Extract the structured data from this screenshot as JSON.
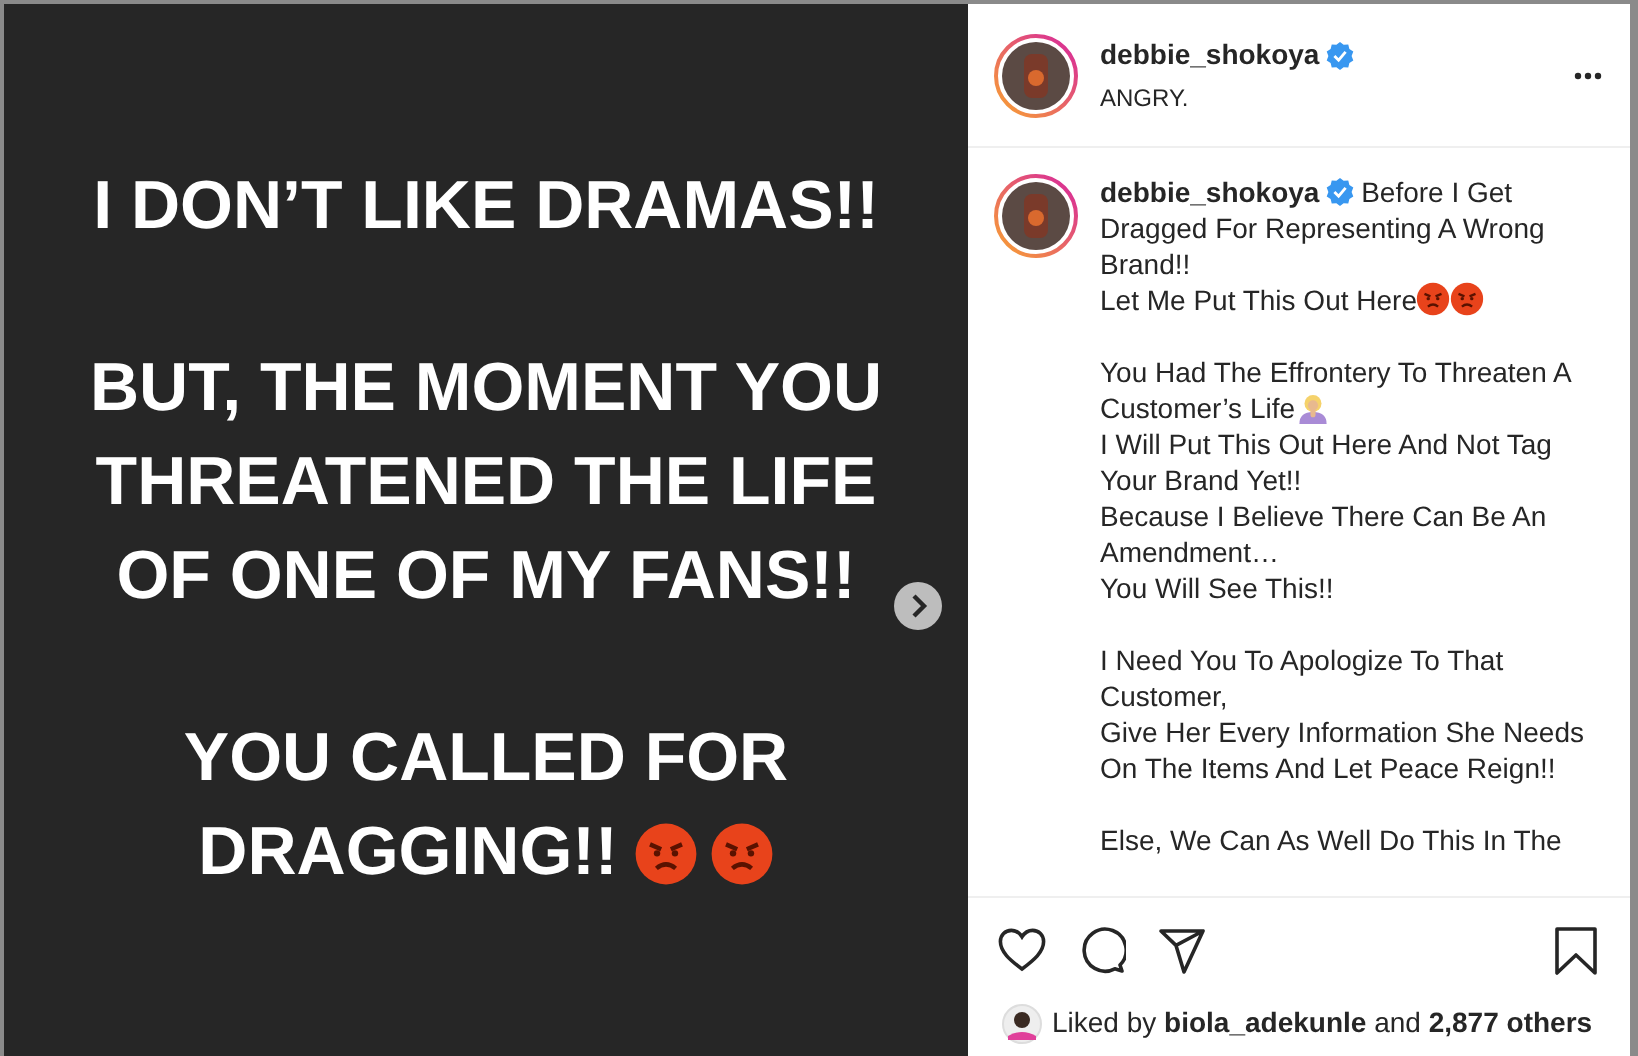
{
  "post_image": {
    "blocks": [
      {
        "lines": [
          {
            "text": "I DON’T LIKE DRAMAS!!"
          }
        ]
      },
      {
        "lines": [
          {
            "text": "BUT, THE MOMENT YOU"
          },
          {
            "text": "THREATENED THE LIFE"
          },
          {
            "text": "OF ONE OF MY FANS!!"
          }
        ]
      },
      {
        "lines": [
          {
            "text": "YOU CALLED FOR"
          },
          {
            "text": "DRAGGING!!",
            "emojis": [
              {
                "kind": "angry"
              },
              {
                "kind": "angry"
              }
            ]
          }
        ]
      }
    ]
  },
  "header": {
    "username": "debbie_shokoya",
    "verified": true,
    "location": "ANGRY."
  },
  "caption": {
    "username": "debbie_shokoya",
    "verified": true,
    "paragraphs": [
      [
        {
          "text": "Before I Get"
        },
        {
          "text": "Dragged For Representing A Wrong"
        },
        {
          "text": "Brand!!"
        },
        {
          "text": "Let Me Put This Out Here",
          "emojis": [
            {
              "kind": "angry"
            },
            {
              "kind": "angry"
            }
          ]
        }
      ],
      [
        {
          "text": "You Had The Effrontery To Threaten A"
        },
        {
          "text": "Customer’s Life",
          "emojis": [
            {
              "kind": "facepalm"
            }
          ]
        },
        {
          "text": "I Will Put This Out Here And Not Tag"
        },
        {
          "text": "Your Brand Yet!!"
        },
        {
          "text": "Because I Believe There Can Be An"
        },
        {
          "text": "Amendment…"
        },
        {
          "text": "You Will See This!!"
        }
      ],
      [
        {
          "text": "I Need You To Apologize To That"
        },
        {
          "text": "Customer,"
        },
        {
          "text": "Give Her Every Information She Needs"
        },
        {
          "text": "On The Items And Let Peace Reign!!"
        }
      ],
      [
        {
          "text": "Else, We Can As Well Do This In The"
        }
      ]
    ]
  },
  "actions": {
    "liked": false,
    "saved": false
  },
  "likes": {
    "prefix": "Liked by",
    "user": "biola_adekunle",
    "suffix": "and 2,877 others"
  }
}
